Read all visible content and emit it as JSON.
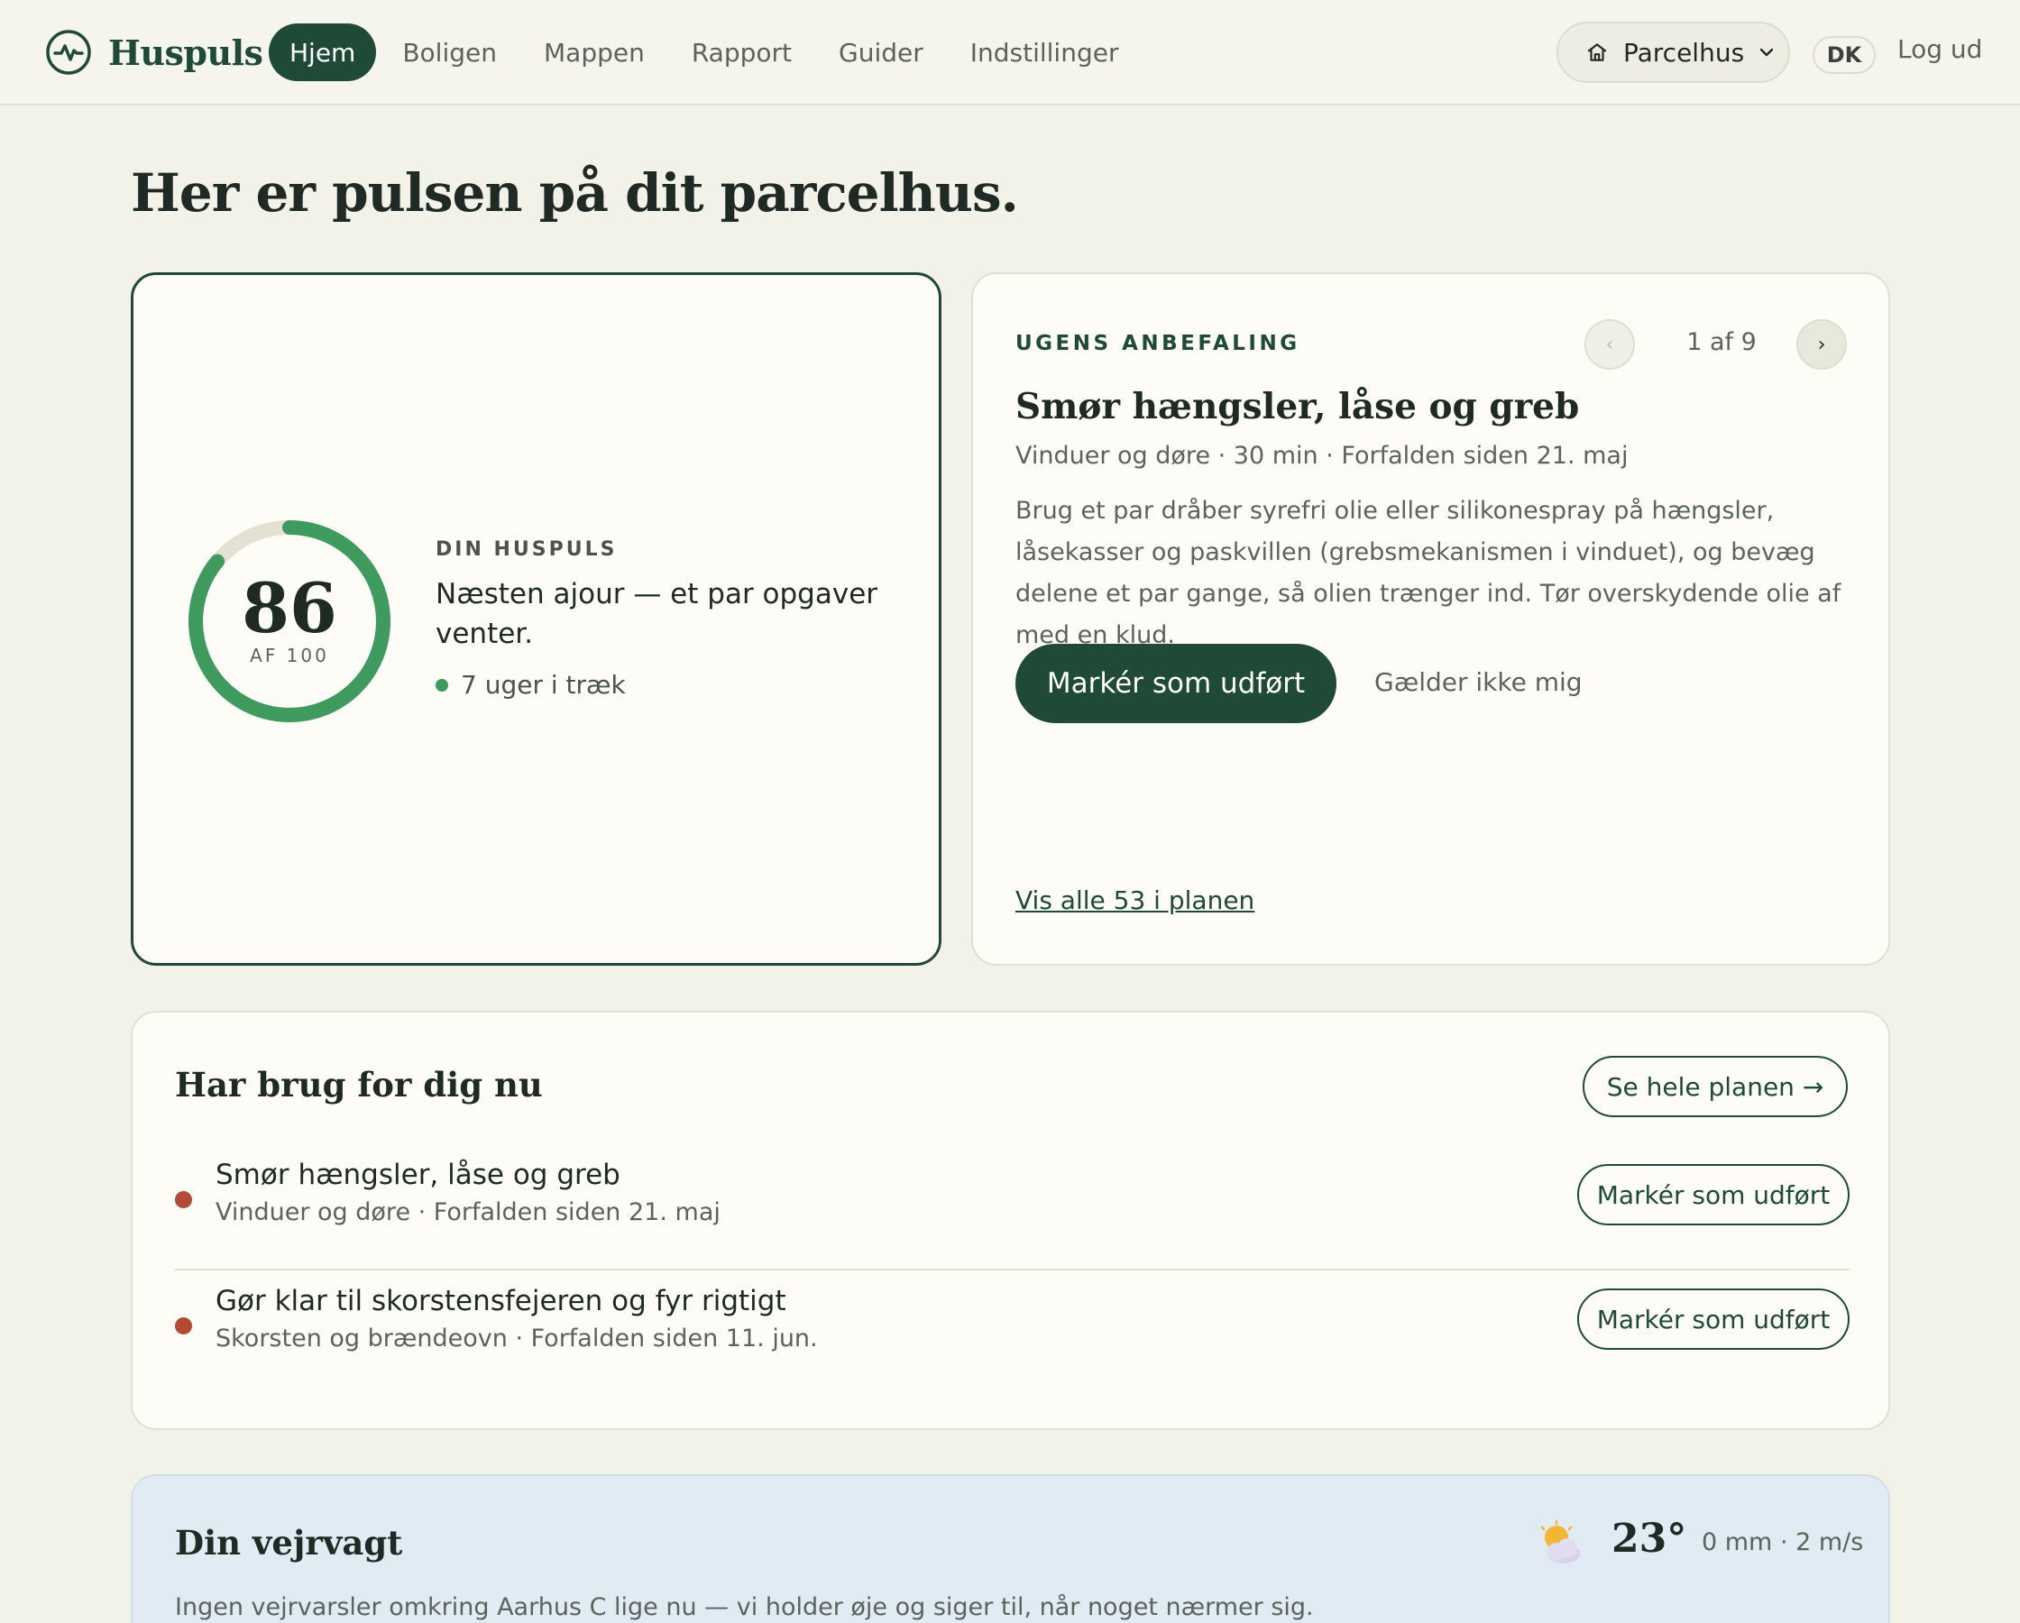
{
  "nav": {
    "brand": "Huspuls",
    "links": [
      "Hjem",
      "Boligen",
      "Mappen",
      "Rapport",
      "Guider",
      "Indstillinger"
    ],
    "house_selector": "Parcelhus",
    "language": "DK",
    "logout": "Log ud"
  },
  "page_title": "Her er pulsen på dit parcelhus.",
  "pulse": {
    "score": "86",
    "score_value": 86,
    "score_max": 100,
    "score_sub": "AF 100",
    "label": "DIN HUSPULS",
    "status": "Næsten ajour — et par opgaver venter.",
    "streak": "7 uger i træk"
  },
  "recommendation": {
    "label": "UGENS ANBEFALING",
    "prev": "‹",
    "next": "›",
    "counter": "1 af 9",
    "title": "Smør hængsler, låse og greb",
    "meta": "Vinduer og døre · 30 min · Forfalden siden 21. maj",
    "body": "Brug et par dråber syrefri olie eller silikonespray på hængsler, låsekasser og paskvillen (grebsmekanismen i vinduet), og bevæg delene et par gange, så olien trænger ind. Tør overskydende olie af med en klud.",
    "primary_button": "Markér som udført",
    "secondary_button": "Gælder ikke mig",
    "link": "Vis alle 53 i planen"
  },
  "needs": {
    "title": "Har brug for dig nu",
    "see_plan": "Se hele planen →",
    "tasks": [
      {
        "name": "Smør hængsler, låse og greb",
        "meta": "Vinduer og døre · Forfalden siden 21. maj",
        "button": "Markér som udført"
      },
      {
        "name": "Gør klar til skorstensfejeren og fyr rigtigt",
        "meta": "Skorsten og brændeovn · Forfalden siden 11. jun.",
        "button": "Markér som udført"
      }
    ]
  },
  "weather": {
    "title": "Din vejrvagt",
    "temp": "23°",
    "meta": "0 mm · 2 m/s",
    "text": "Ingen vejrvarsler omkring Aarhus C lige nu — vi holder øje og siger til, når noget nærmer sig.",
    "icon": "partly-cloudy-icon"
  },
  "colors": {
    "brand": "#1e4a37",
    "ring_fill": "#3f9a5e",
    "ring_track": "#e4e1d4",
    "overdue": "#b24a36",
    "background": "#f3f2e9"
  }
}
